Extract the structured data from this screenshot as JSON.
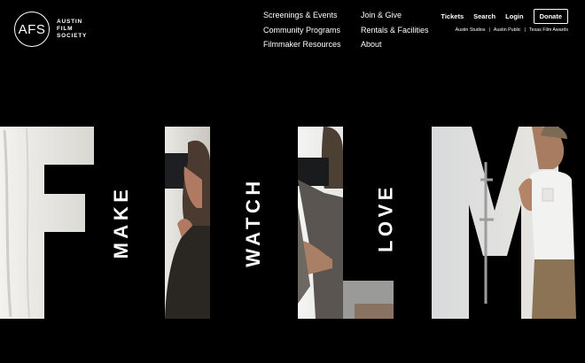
{
  "logo": {
    "mark": "AFS",
    "words": [
      "AUSTIN",
      "FILM",
      "SOCIETY"
    ]
  },
  "nav": {
    "col1": [
      "Screenings & Events",
      "Community Programs",
      "Filmmaker Resources"
    ],
    "col2": [
      "Join & Give",
      "Rentals & Facilities",
      "About"
    ]
  },
  "utility": {
    "tickets": "Tickets",
    "search": "Search",
    "login": "Login",
    "donate": "Donate"
  },
  "sub_links": [
    "Austin Studios",
    "Austin Public",
    "Texas Film Awards"
  ],
  "sub_separator": "|",
  "hero": {
    "taglines": [
      "MAKE",
      "WATCH",
      "LOVE"
    ]
  },
  "colors": {
    "background": "#000000",
    "text": "#ffffff"
  }
}
